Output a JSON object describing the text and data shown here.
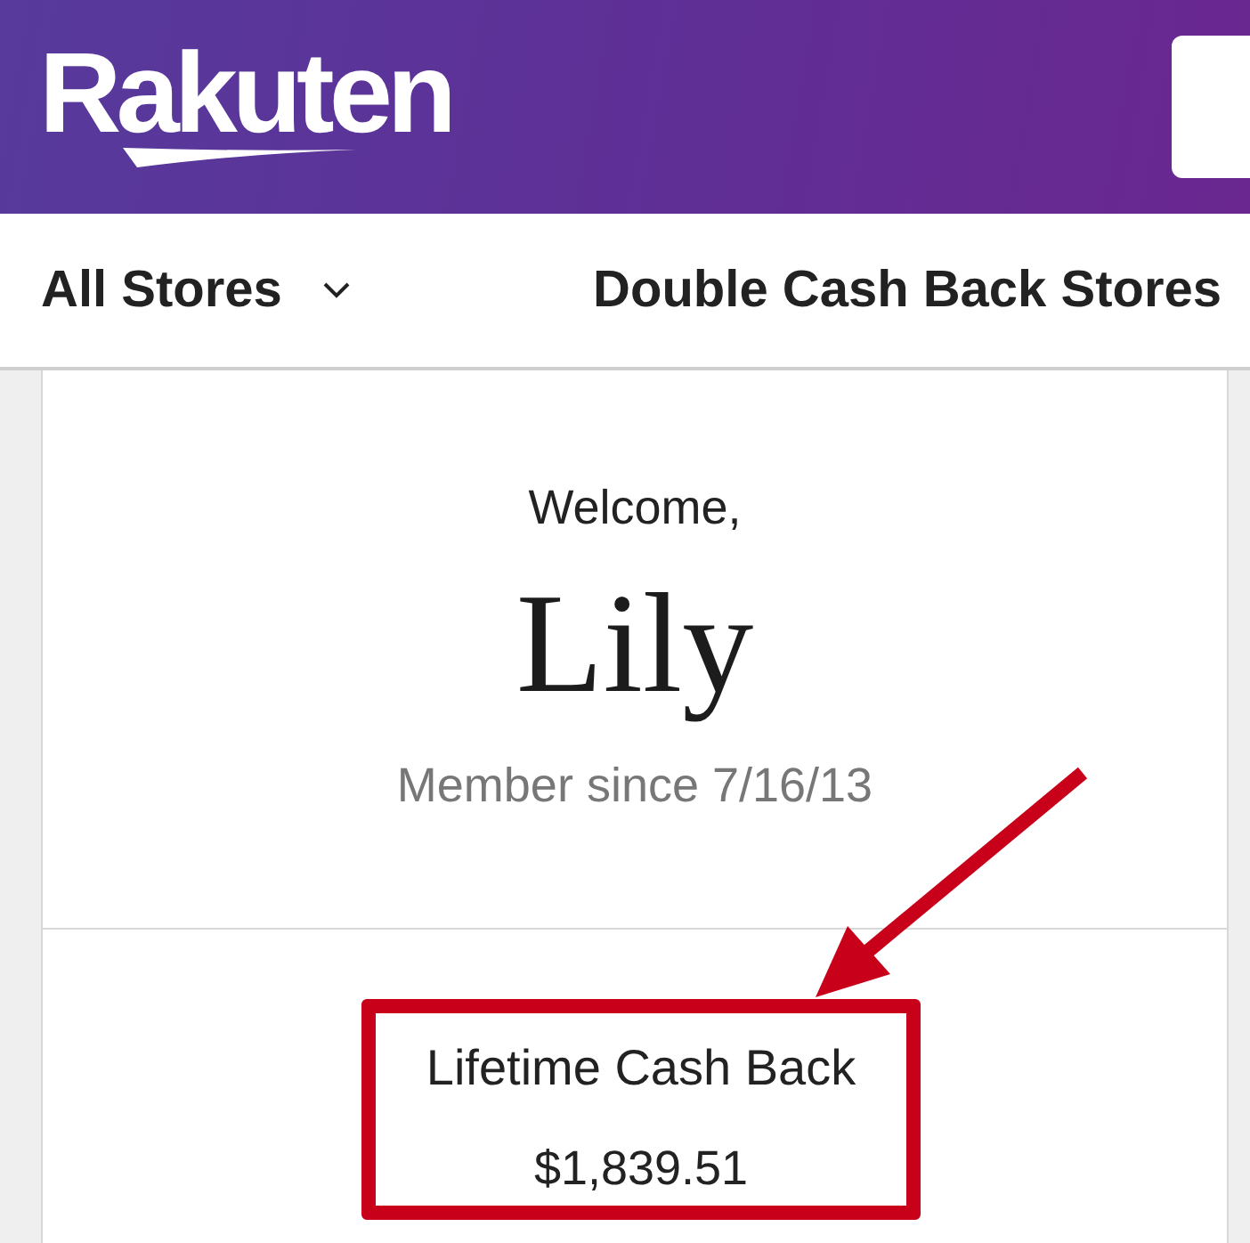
{
  "header": {
    "logo": "Rakuten"
  },
  "nav": {
    "items": [
      {
        "label": "All Stores",
        "kind": "dropdown"
      },
      {
        "label": "Double Cash Back Stores",
        "kind": "link"
      }
    ]
  },
  "profile": {
    "greeting": "Welcome,",
    "name": "Lily",
    "member_since": "Member since 7/16/13"
  },
  "stats": {
    "label": "Lifetime Cash Back",
    "value": "$1,839.51",
    "highlighted": true
  }
}
